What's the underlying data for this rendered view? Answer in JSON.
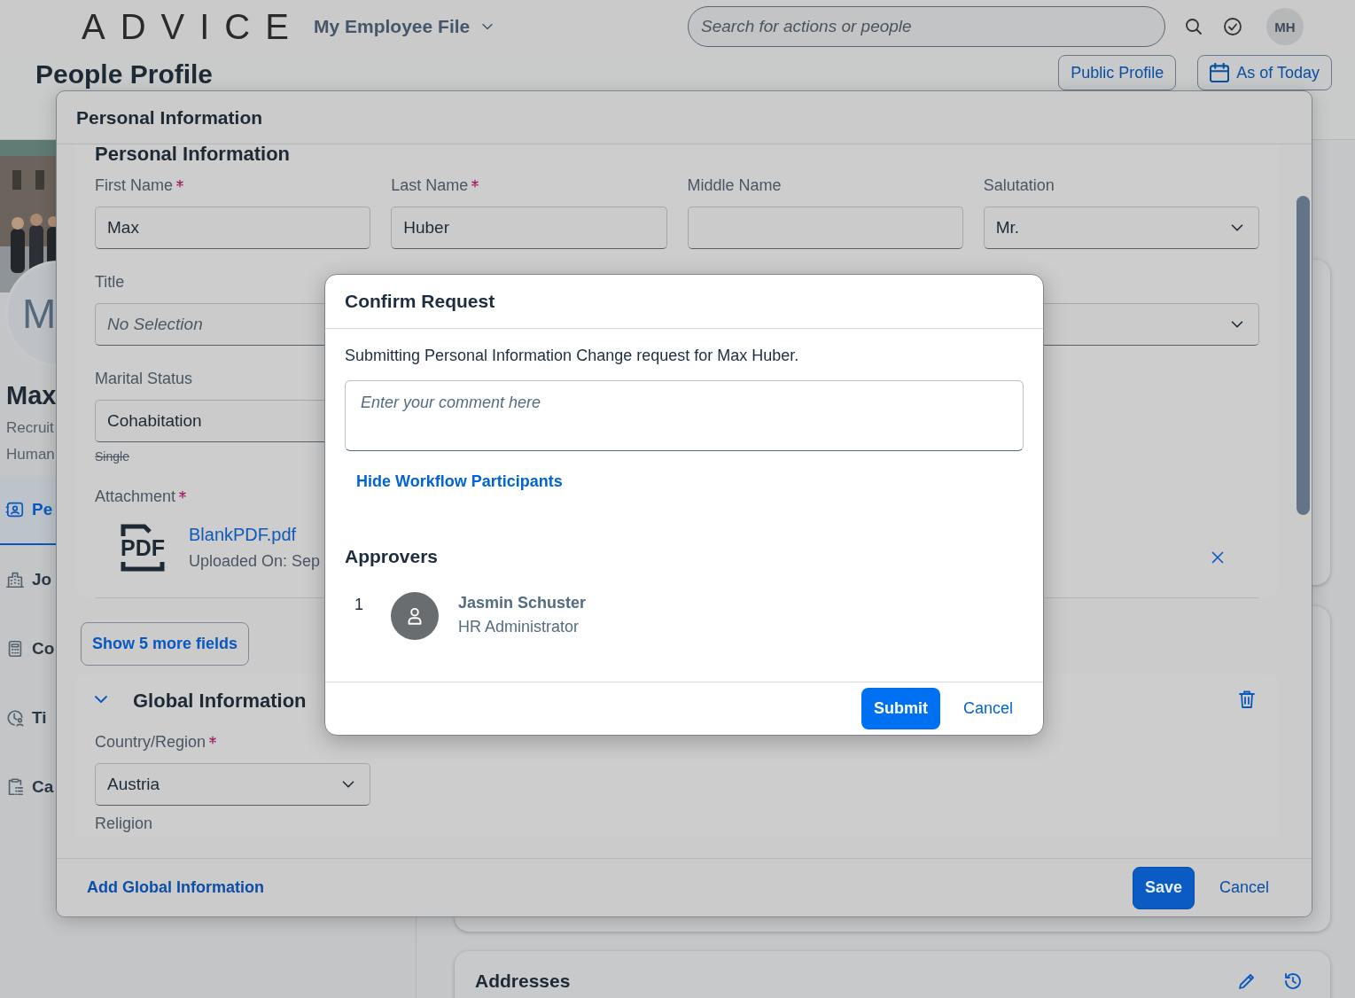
{
  "shell": {
    "logo": "ADVICE",
    "app_title": "My Employee File",
    "search": {
      "placeholder": "Search for actions or people"
    },
    "user_initials": "MH"
  },
  "page": {
    "title": "People Profile",
    "header_buttons": [
      {
        "label": "Public Profile",
        "kind": "plain"
      },
      {
        "label": "As of Today",
        "kind": "calendar"
      }
    ]
  },
  "profile": {
    "avatar_initial": "M",
    "name": "Max",
    "lines": [
      "Recruit",
      "Human"
    ]
  },
  "nav": [
    {
      "label": "Pe",
      "selected": true
    },
    {
      "label": "Jo",
      "selected": false
    },
    {
      "label": "Co",
      "selected": false
    },
    {
      "label": "Ti",
      "selected": false
    },
    {
      "label": "Ca",
      "selected": false
    }
  ],
  "cards": [
    {
      "title": "Addresses"
    }
  ],
  "edit_dialog": {
    "title": "Personal Information",
    "section_title": "Personal Information",
    "field_rows": [
      [
        {
          "label": "First Name",
          "required": true,
          "value": "Max",
          "kind": "input"
        },
        {
          "label": "Last Name",
          "required": true,
          "value": "Huber",
          "kind": "input"
        },
        {
          "label": "Middle Name",
          "required": false,
          "kind": "input"
        },
        {
          "label": "Salutation",
          "required": false,
          "value": "Mr.",
          "kind": "select"
        }
      ],
      [
        {
          "label": "Title",
          "required": false,
          "placeholder": "No Selection",
          "kind": "input"
        },
        {
          "kind": "select"
        }
      ],
      [
        {
          "label": "Marital Status",
          "required": false,
          "value": "Cohabitation",
          "previous_value": "Single",
          "kind": "input"
        }
      ]
    ],
    "attachment": {
      "label": "Attachment",
      "required": true,
      "file_type": "PDF",
      "file_name": "BlankPDF.pdf",
      "uploaded": "Uploaded On: Sep"
    },
    "more_button": "Show 5 more fields",
    "global_section": {
      "title": "Global Information",
      "expanded": true,
      "fields": [
        {
          "label": "Country/Region",
          "required": true,
          "value": "Austria",
          "kind": "select"
        },
        {
          "label": "Religion",
          "required": false,
          "kind": "label"
        }
      ]
    },
    "footer": {
      "link": "Add Global Information",
      "buttons": [
        {
          "label": "Save",
          "kind": "emphasized"
        },
        {
          "label": "Cancel",
          "kind": "transparent"
        }
      ]
    }
  },
  "confirm_dialog": {
    "title": "Confirm Request",
    "message": "Submitting Personal Information Change request for Max Huber.",
    "comment": {
      "placeholder": "Enter your comment here"
    },
    "toggle_link": "Hide Workflow Participants",
    "approvers_title": "Approvers",
    "approvers": [
      {
        "step": "1",
        "name": "Jasmin Schuster",
        "role": "HR Administrator"
      }
    ],
    "buttons": [
      {
        "label": "Submit",
        "kind": "emphasized"
      },
      {
        "label": "Cancel",
        "kind": "transparent"
      }
    ]
  }
}
